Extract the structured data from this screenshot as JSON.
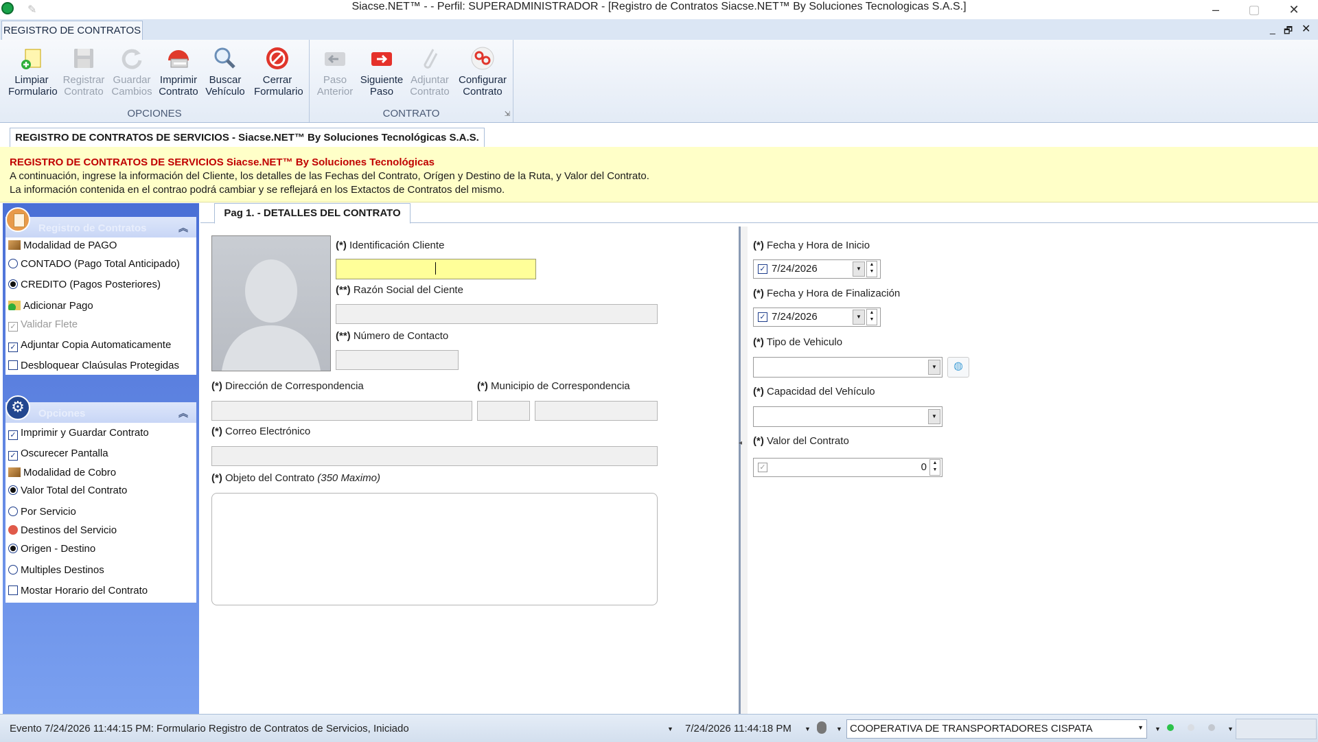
{
  "window": {
    "title": "Siacse.NET™ -  - Perfil: SUPERADMINISTRADOR - [Registro de Contratos Siacse.NET™ By Soluciones Tecnologicas S.A.S.]"
  },
  "ribbon": {
    "tab_label": "REGISTRO DE CONTRATOS",
    "groups": {
      "opciones": "OPCIONES",
      "contrato": "CONTRATO"
    },
    "buttons": {
      "limpiar": [
        "Limpiar",
        "Formulario"
      ],
      "registrar": [
        "Registrar",
        "Contrato"
      ],
      "guardar": [
        "Guardar",
        "Cambios"
      ],
      "imprimir": [
        "Imprimir",
        "Contrato"
      ],
      "buscar": [
        "Buscar",
        "Vehículo"
      ],
      "cerrar": [
        "Cerrar",
        "Formulario"
      ],
      "paso_anterior": [
        "Paso",
        "Anterior"
      ],
      "siguiente": [
        "Siguiente",
        "Paso"
      ],
      "adjuntar": [
        "Adjuntar",
        "Contrato"
      ],
      "configurar": [
        "Configurar",
        "Contrato"
      ]
    }
  },
  "doc_tab": "REGISTRO DE CONTRATOS DE SERVICIOS - Siacse.NET™ By Soluciones Tecnológicas S.A.S.",
  "banner": {
    "title": "REGISTRO DE CONTRATOS DE SERVICIOS Siacse.NET™ By Soluciones Tecnológicas",
    "line1": "A continuación, ingrese la información del Cliente, los detalles de las Fechas del Contrato, Orígen y Destino de la Ruta, y Valor del Contrato.",
    "line2": "La información contenida en el contrao podrá cambiar y se reflejará en los Extactos de Contratos del mismo."
  },
  "left_panel": {
    "group1_title": "Registro de Contratos",
    "modalidad_pago": "Modalidad de PAGO",
    "contado": "CONTADO (Pago Total Anticipado)",
    "credito": "CREDITO (Pagos Posteriores)",
    "adicionar_pago": "Adicionar Pago",
    "validar_flete": "Validar Flete",
    "adjuntar_copia": "Adjuntar Copia Automaticamente",
    "desbloquear": "Desbloquear Claúsulas Protegidas",
    "group2_title": "Opciones",
    "imprimir_guardar": "Imprimir y Guardar Contrato",
    "oscurecer": "Oscurecer Pantalla",
    "modalidad_cobro": "Modalidad de Cobro",
    "valor_total": "Valor Total del Contrato",
    "por_servicio": "Por Servicio",
    "destinos": "Destinos del Servicio",
    "origen_destino": "Origen - Destino",
    "multiples": "Multiples Destinos",
    "mostrar_horario": "Mostar Horario del Contrato"
  },
  "form": {
    "page_tab": "Pag 1. - DETALLES DEL CONTRATO",
    "id_cliente": [
      "(*)",
      " Identificación Cliente"
    ],
    "razon_social": [
      "(**)",
      " Razón Social del Ciente"
    ],
    "numero_contacto": [
      "(**)",
      " Número de Contacto"
    ],
    "direccion": [
      "(*)",
      " Dirección de Correspondencia"
    ],
    "municipio": [
      "(*)",
      " Municipio de Correspondencia"
    ],
    "correo": [
      "(*)",
      " Correo Electrónico"
    ],
    "objeto": [
      "(*)",
      " Objeto del Contrato ",
      "(350 Maximo)"
    ],
    "fecha_inicio": [
      "(*)",
      " Fecha y Hora de Inicio"
    ],
    "fecha_inicio_value": "7/24/2026",
    "fecha_fin": [
      "(*)",
      " Fecha y Hora de Finalización"
    ],
    "fecha_fin_value": "7/24/2026",
    "tipo_vehiculo": [
      "(*)",
      " Tipo de Vehiculo"
    ],
    "capacidad": [
      "(*)",
      " Capacidad del Vehículo"
    ],
    "valor": [
      "(*)",
      " Valor del Contrato"
    ],
    "valor_value": "0"
  },
  "status": {
    "evento": "Evento 7/24/2026 11:44:15 PM: Formulario Registro de Contratos de Servicios, Iniciado",
    "datetime": "7/24/2026 11:44:18 PM",
    "company": "COOPERATIVA DE TRANSPORTADORES CISPATA"
  },
  "colors": {
    "accent_blue": "#4a6fd6",
    "banner_bg": "#ffffc8",
    "banner_title": "#c00000",
    "input_highlight": "#ffff99"
  }
}
